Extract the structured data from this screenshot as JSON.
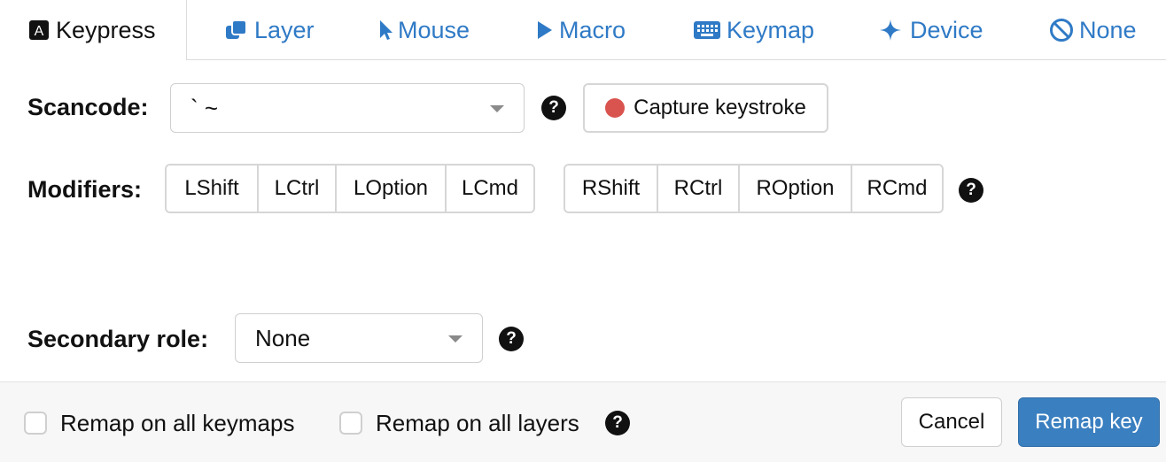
{
  "tabs": [
    {
      "label": "Keypress",
      "icon": "keyboard-a-icon",
      "active": true
    },
    {
      "label": "Layer",
      "icon": "layer-icon"
    },
    {
      "label": "Mouse",
      "icon": "mouse-pointer-icon"
    },
    {
      "label": "Macro",
      "icon": "play-icon"
    },
    {
      "label": "Keymap",
      "icon": "keyboard-icon"
    },
    {
      "label": "Device",
      "icon": "sparkle-icon"
    },
    {
      "label": "None",
      "icon": "ban-icon"
    }
  ],
  "scancode": {
    "label": "Scancode:",
    "value": "` ~",
    "help": "?",
    "capture_label": "Capture keystroke"
  },
  "modifiers": {
    "label": "Modifiers:",
    "left": [
      "LShift",
      "LCtrl",
      "LOption",
      "LCmd"
    ],
    "right": [
      "RShift",
      "RCtrl",
      "ROption",
      "RCmd"
    ],
    "help": "?"
  },
  "secondary_role": {
    "label": "Secondary role:",
    "value": "None",
    "help": "?"
  },
  "footer": {
    "remap_keymaps_label": "Remap on all keymaps",
    "remap_layers_label": "Remap on all layers",
    "help": "?",
    "cancel_label": "Cancel",
    "remap_label": "Remap key"
  },
  "colors": {
    "accent": "#2f7ac6",
    "primary_button": "#3a7fc0",
    "record_dot": "#d9534f"
  }
}
